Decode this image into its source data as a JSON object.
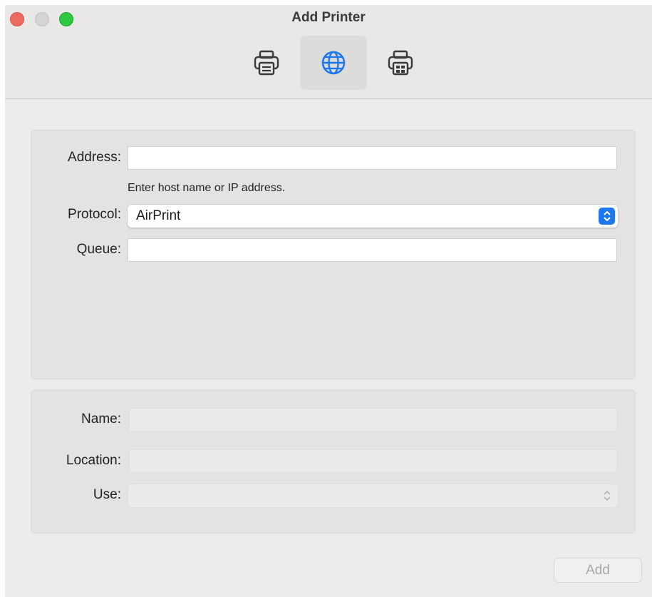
{
  "window": {
    "title": "Add Printer"
  },
  "toolbar": {
    "items": [
      {
        "name": "default-printer",
        "icon": "printer-icon",
        "selected": false
      },
      {
        "name": "ip-printer",
        "icon": "globe-icon",
        "selected": true
      },
      {
        "name": "windows-printer",
        "icon": "printer-windows-icon",
        "selected": false
      }
    ]
  },
  "form": {
    "address_label": "Address:",
    "address_value": "",
    "address_hint": "Enter host name or IP address.",
    "protocol_label": "Protocol:",
    "protocol_value": "AirPrint",
    "queue_label": "Queue:",
    "queue_value": ""
  },
  "details": {
    "name_label": "Name:",
    "location_label": "Location:",
    "use_label": "Use:",
    "use_value": ""
  },
  "footer": {
    "add_label": "Add"
  },
  "colors": {
    "accent": "#1d78f0",
    "close": "#ed6a5e",
    "maximize": "#2fc840"
  }
}
